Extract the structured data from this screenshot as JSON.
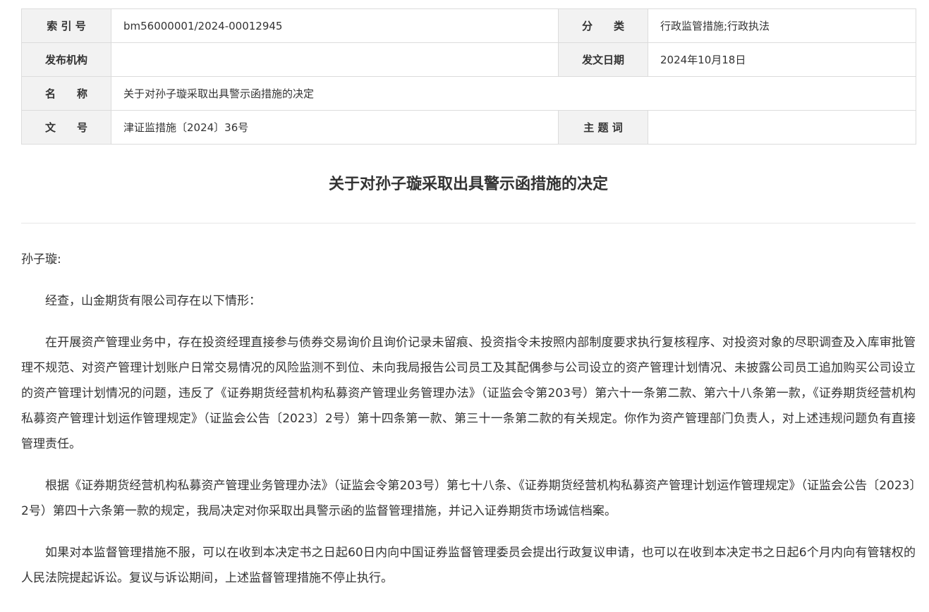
{
  "meta": {
    "index_label": "索 引 号",
    "index_value": "bm56000001/2024-00012945",
    "category_label": "分　　类",
    "category_value": "行政监管措施;行政执法",
    "publisher_label": "发布机构",
    "publisher_value": "",
    "date_label": "发文日期",
    "date_value": "2024年10月18日",
    "name_label": "名　　称",
    "name_value": "关于对孙子璇采取出具警示函措施的决定",
    "docno_label": "文　　号",
    "docno_value": "津证监措施〔2024〕36号",
    "subject_label": "主 题 词",
    "subject_value": ""
  },
  "document": {
    "title": "关于对孙子璇采取出具警示函措施的决定",
    "salutation": "孙子璇:",
    "paragraphs": [
      "经查，山金期货有限公司存在以下情形：",
      "在开展资产管理业务中，存在投资经理直接参与债券交易询价且询价记录未留痕、投资指令未按照内部制度要求执行复核程序、对投资对象的尽职调查及入库审批管理不规范、对资产管理计划账户日常交易情况的风险监测不到位、未向我局报告公司员工及其配偶参与公司设立的资产管理计划情况、未披露公司员工追加购买公司设立的资产管理计划情况的问题，违反了《证券期货经营机构私募资产管理业务管理办法》（证监会令第203号）第六十一条第二款、第六十八条第一款，《证券期货经营机构私募资产管理计划运作管理规定》（证监会公告〔2023〕2号）第十四条第一款、第三十一条第二款的有关规定。你作为资产管理部门负责人，对上述违规问题负有直接管理责任。",
      "根据《证券期货经营机构私募资产管理业务管理办法》（证监会令第203号）第七十八条、《证券期货经营机构私募资产管理计划运作管理规定》（证监会公告〔2023〕2号）第四十六条第一款的规定，我局决定对你采取出具警示函的监督管理措施，并记入证券期货市场诚信档案。",
      "如果对本监督管理措施不服，可以在收到本决定书之日起60日内向中国证券监督管理委员会提出行政复议申请，也可以在收到本决定书之日起6个月内向有管辖权的人民法院提起诉讼。复议与诉讼期间，上述监督管理措施不停止执行。"
    ]
  }
}
